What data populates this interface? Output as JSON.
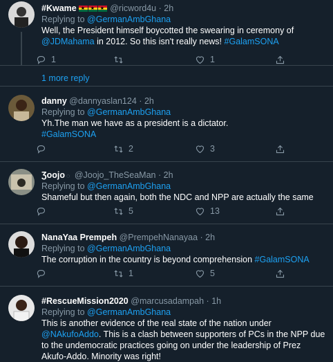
{
  "tweets": [
    {
      "name": "#Kwame",
      "handle": "@ricword4u",
      "dot": "·",
      "time": "2h",
      "replying_prefix": "Replying to",
      "replying_to": "@GermanAmbGhana",
      "text_a": "Well, the President himself boycotted the swearing in ceremony of",
      "text_mention": "@JDMahama",
      "text_b": " in 2012. So this isn't really news! ",
      "text_tag": "#GalamSONA",
      "reply_count": "1",
      "retweet_count": "",
      "like_count": "1"
    },
    {
      "name": "danny",
      "handle": "@dannyaslan124",
      "dot": "·",
      "time": "2h",
      "replying_prefix": "Replying to",
      "replying_to": "@GermanAmbGhana",
      "text_a": "Yh.The man we have as a president is a dictator.",
      "text_tag": "#GalamSONA",
      "reply_count": "",
      "retweet_count": "2",
      "like_count": "3"
    },
    {
      "name": "Ʒoojo",
      "handle": "@Joojo_TheSeaMan",
      "dot": "·",
      "time": "2h",
      "replying_prefix": "Replying to",
      "replying_to": "@GermanAmbGhana",
      "text_a": "Shameful but then again, both the NDC and  NPP are actually the same",
      "reply_count": "",
      "retweet_count": "5",
      "like_count": "13"
    },
    {
      "name": "NanaYaa Prempeh",
      "handle": "@PrempehNanayaa",
      "dot": "·",
      "time": "2h",
      "replying_prefix": "Replying to",
      "replying_to": "@GermanAmbGhana",
      "text_a": "The corruption in the country is beyond comprehension ",
      "text_tag": "#GalamSONA",
      "reply_count": "",
      "retweet_count": "1",
      "like_count": "5"
    },
    {
      "name": "#RescueMission2020",
      "handle": "@marcusadampah",
      "dot": "·",
      "time": "1h",
      "replying_prefix": "Replying to",
      "replying_to": "@GermanAmbGhana",
      "text_a": "This is another evidence of the real state of the nation under ",
      "text_mention": "@NAkufoAddo",
      "text_b": ". This is a clash between supporters of PCs in the NPP due to the undemocratic practices going on under the leadership of Prez Akufo-Addo. Minority was right!"
    }
  ],
  "more_replies": "1 more reply",
  "colors": {
    "background": "#15202b",
    "accent": "#1da1f2",
    "muted": "#8899a6",
    "border": "#38444d"
  },
  "icons": [
    "reply-icon",
    "retweet-icon",
    "like-icon",
    "share-icon"
  ]
}
